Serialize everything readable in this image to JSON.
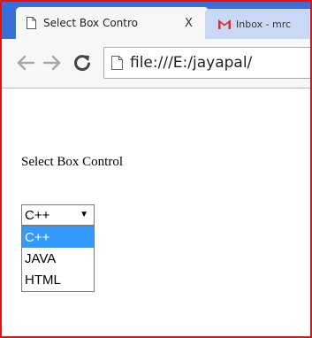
{
  "browser": {
    "tabs": [
      {
        "title": "Select Box Contro",
        "close_label": "X",
        "icon": "doc-icon"
      },
      {
        "title": "Inbox - mrc",
        "icon": "gmail-icon"
      }
    ],
    "toolbar": {
      "back_icon": "arrow-left-icon",
      "forward_icon": "arrow-right-icon",
      "reload_label": "C",
      "url": "file:///E:/jayapal/"
    }
  },
  "page": {
    "heading": "Select Box Control",
    "select": {
      "selected_value": "C++",
      "options": [
        "C++",
        "JAVA",
        "HTML"
      ],
      "highlighted_index": 0
    }
  },
  "colors": {
    "frame_border": "#d81818",
    "tabstrip": "#3a6fd9",
    "option_highlight": "#3399ff"
  }
}
